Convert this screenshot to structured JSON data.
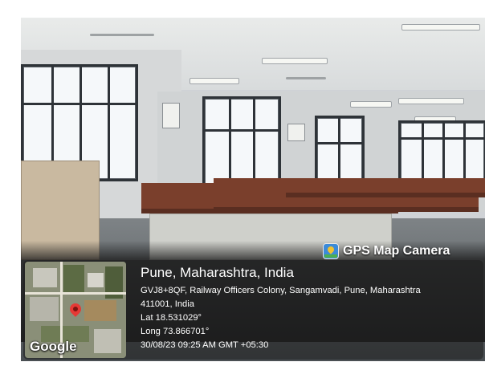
{
  "overlay": {
    "app_label": "GPS Map Camera",
    "location_title": "Pune, Maharashtra, India",
    "address_line1": "GVJ8+8QF, Railway Officers Colony, Sangamvadi, Pune, Maharashtra",
    "address_line2": "411001, India",
    "latitude": "Lat 18.531029°",
    "longitude": "Long 73.866701°",
    "datetime": "30/08/23 09:25 AM GMT +05:30",
    "map_provider": "Google"
  },
  "icons": {
    "app_icon": "map-pin-camera-icon",
    "location_marker": "map-pin-icon"
  },
  "colors": {
    "marker": "#e53935",
    "bench_top": "#7a3f2c",
    "overlay_text": "#ffffff"
  }
}
